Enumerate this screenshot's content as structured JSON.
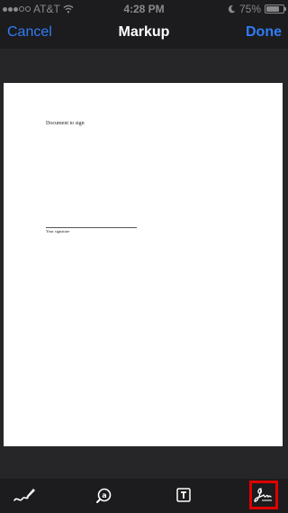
{
  "status_bar": {
    "carrier": "AT&T",
    "time": "4:28 PM",
    "battery_percent": "75%",
    "battery_level": 0.75
  },
  "nav": {
    "cancel_label": "Cancel",
    "title": "Markup",
    "done_label": "Done"
  },
  "document": {
    "heading": "Document to sign",
    "signature_label": "Your signature"
  },
  "toolbar": {
    "tools": [
      {
        "name": "draw",
        "icon": "pen-draw-icon"
      },
      {
        "name": "magnifier",
        "icon": "magnifier-icon"
      },
      {
        "name": "text",
        "icon": "text-box-icon"
      },
      {
        "name": "signature",
        "icon": "signature-icon",
        "highlighted": true
      }
    ],
    "highlight_color": "#e00000"
  },
  "colors": {
    "accent": "#2f7cf6",
    "bar_background": "#1c1c1e",
    "canvas_background": "#262628",
    "page_background": "#ffffff"
  }
}
